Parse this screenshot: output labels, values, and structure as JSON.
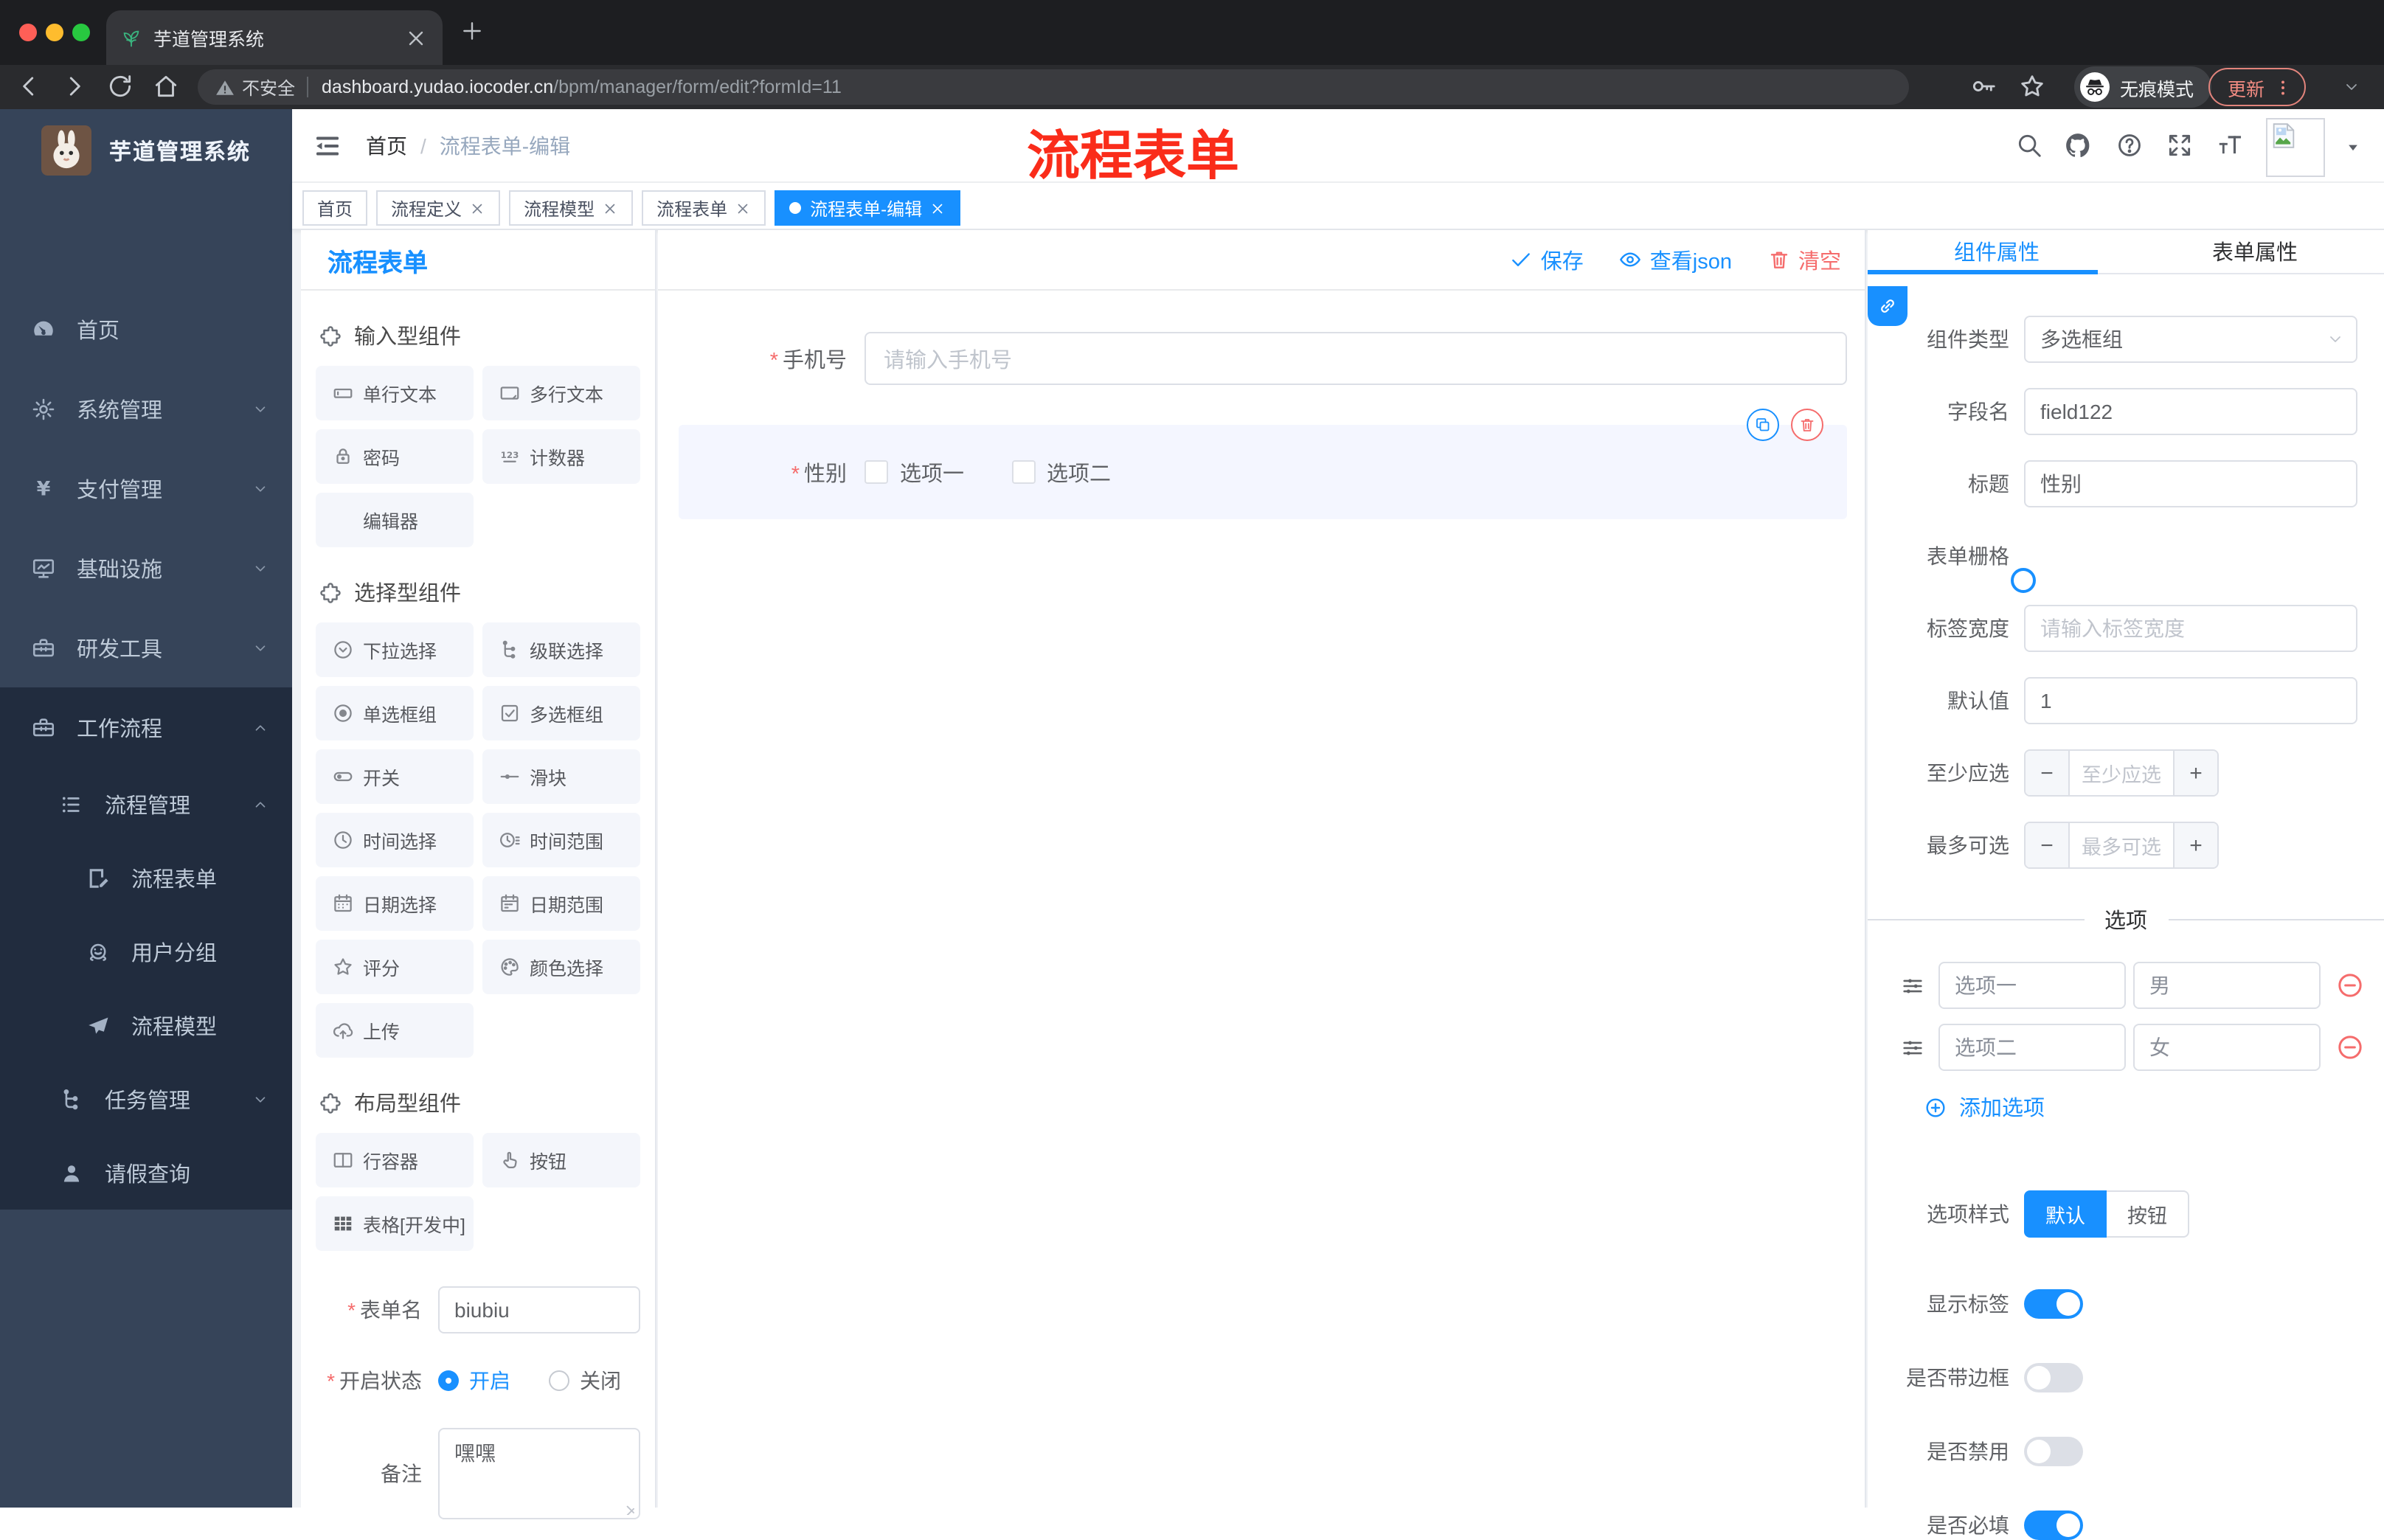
{
  "browser": {
    "tab_title": "芋道管理系统",
    "security_label": "不安全",
    "url_host": "dashboard.yudao.iocoder.cn",
    "url_path": "/bpm/manager/form/edit?formId=11",
    "incognito_label": "无痕模式",
    "update_label": "更新"
  },
  "annotation": {
    "text": "流程表单",
    "color": "#fa2c1a"
  },
  "app": {
    "logo_title": "芋道管理系统",
    "breadcrumb": {
      "first": "首页",
      "separator": "/",
      "current": "流程表单-编辑"
    },
    "sidebar": [
      {
        "label": "首页",
        "icon": "dashboard-icon",
        "level": 1,
        "chevron": "",
        "dark": false
      },
      {
        "label": "系统管理",
        "icon": "gear-icon",
        "level": 1,
        "chevron": "down",
        "dark": false
      },
      {
        "label": "支付管理",
        "icon": "yen-icon",
        "level": 1,
        "chevron": "down",
        "dark": false
      },
      {
        "label": "基础设施",
        "icon": "monitor-icon",
        "level": 1,
        "chevron": "down",
        "dark": false
      },
      {
        "label": "研发工具",
        "icon": "toolbox-icon",
        "level": 1,
        "chevron": "down",
        "dark": false
      },
      {
        "label": "工作流程",
        "icon": "briefcase-icon",
        "level": 1,
        "chevron": "up",
        "dark": true
      },
      {
        "label": "流程管理",
        "icon": "list-icon",
        "level": 2,
        "chevron": "up",
        "dark": true
      },
      {
        "label": "流程表单",
        "icon": "doc-edit-icon",
        "level": 3,
        "chevron": "",
        "dark": true
      },
      {
        "label": "用户分组",
        "icon": "face-icon",
        "level": 3,
        "chevron": "",
        "dark": true
      },
      {
        "label": "流程模型",
        "icon": "plane-icon",
        "level": 3,
        "chevron": "",
        "dark": true
      },
      {
        "label": "任务管理",
        "icon": "tree-icon",
        "level": 2,
        "chevron": "down",
        "dark": true
      },
      {
        "label": "请假查询",
        "icon": "user-icon",
        "level": 2,
        "chevron": "",
        "dark": true
      }
    ],
    "tags": [
      {
        "label": "首页",
        "closable": false,
        "active": false
      },
      {
        "label": "流程定义",
        "closable": true,
        "active": false
      },
      {
        "label": "流程模型",
        "closable": true,
        "active": false
      },
      {
        "label": "流程表单",
        "closable": true,
        "active": false
      },
      {
        "label": "流程表单-编辑",
        "closable": true,
        "active": true
      }
    ]
  },
  "palette": {
    "title": "流程表单",
    "sections": [
      {
        "title": "输入型组件",
        "items": [
          {
            "icon": "input-icon",
            "label": "单行文本"
          },
          {
            "icon": "textarea-icon",
            "label": "多行文本"
          },
          {
            "icon": "lock-icon",
            "label": "密码"
          },
          {
            "icon": "counter-icon",
            "label": "计数器"
          },
          {
            "icon": "blank-icon",
            "label": "编辑器"
          }
        ]
      },
      {
        "title": "选择型组件",
        "items": [
          {
            "icon": "select-icon",
            "label": "下拉选择"
          },
          {
            "icon": "cascader-icon",
            "label": "级联选择"
          },
          {
            "icon": "radio-icon",
            "label": "单选框组"
          },
          {
            "icon": "checkbox-icon",
            "label": "多选框组"
          },
          {
            "icon": "switch-icon",
            "label": "开关"
          },
          {
            "icon": "slider-icon",
            "label": "滑块"
          },
          {
            "icon": "time-icon",
            "label": "时间选择"
          },
          {
            "icon": "time-range-icon",
            "label": "时间范围"
          },
          {
            "icon": "date-icon",
            "label": "日期选择"
          },
          {
            "icon": "date-range-icon",
            "label": "日期范围"
          },
          {
            "icon": "star-icon",
            "label": "评分"
          },
          {
            "icon": "color-icon",
            "label": "颜色选择"
          },
          {
            "icon": "upload-icon",
            "label": "上传"
          }
        ]
      },
      {
        "title": "布局型组件",
        "items": [
          {
            "icon": "row-icon",
            "label": "行容器"
          },
          {
            "icon": "button-icon",
            "label": "按钮"
          },
          {
            "icon": "table-icon",
            "label": "表格[开发中]"
          }
        ]
      }
    ],
    "form": {
      "name_label": "表单名",
      "name_value": "biubiu",
      "status_label": "开启状态",
      "status_on": "开启",
      "status_off": "关闭",
      "status_selected": "开启",
      "remark_label": "备注",
      "remark_value": "嘿嘿"
    }
  },
  "canvas": {
    "actions": [
      {
        "icon": "check-icon",
        "label": "保存",
        "danger": false
      },
      {
        "icon": "eye-icon",
        "label": "查看json",
        "danger": false
      },
      {
        "icon": "trash-icon",
        "label": "清空",
        "danger": true
      }
    ],
    "phone_field": {
      "label": "手机号",
      "placeholder": "请输入手机号"
    },
    "gender_field": {
      "label": "性别",
      "option1": "选项一",
      "option2": "选项二"
    }
  },
  "inspector": {
    "tab_component": "组件属性",
    "tab_form": "表单属性",
    "component_type": {
      "label": "组件类型",
      "value": "多选框组"
    },
    "field_name": {
      "label": "字段名",
      "value": "field122"
    },
    "title_row": {
      "label": "标题",
      "value": "性别"
    },
    "grid_row": {
      "label": "表单栅格"
    },
    "label_width": {
      "label": "标签宽度",
      "placeholder": "请输入标签宽度"
    },
    "default_value": {
      "label": "默认值",
      "value": "1"
    },
    "min_checked": {
      "label": "至少应选",
      "placeholder": "至少应选"
    },
    "max_checked": {
      "label": "最多可选",
      "placeholder": "最多可选"
    },
    "options_divider": "选项",
    "options": [
      {
        "label": "选项一",
        "value": "男"
      },
      {
        "label": "选项二",
        "value": "女"
      }
    ],
    "add_option_label": "添加选项",
    "style_row": {
      "label": "选项样式",
      "options": [
        "默认",
        "按钮"
      ],
      "selected": "默认"
    },
    "switch_rows": [
      {
        "label": "显示标签",
        "on": true
      },
      {
        "label": "是否带边框",
        "on": false
      },
      {
        "label": "是否禁用",
        "on": false
      },
      {
        "label": "是否必填",
        "on": true
      }
    ]
  },
  "colors": {
    "accent": "#1890ff",
    "danger": "#f56c6c",
    "sidebar_bg": "#364459",
    "sidebar_dark_bg": "#212c3e"
  }
}
